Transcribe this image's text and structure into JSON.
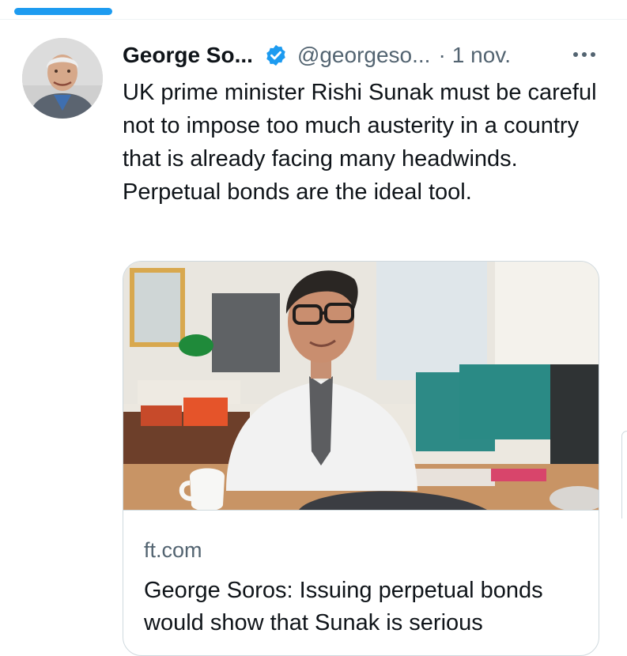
{
  "tweet": {
    "author_name": "George So...",
    "handle": "@georgeso...",
    "separator": "·",
    "timestamp": "1 nov.",
    "text": "UK prime minister Rishi Sunak must be careful not to impose too much austerity in a country that is already facing many headwinds. Perpetual bonds are the ideal tool.",
    "verified": true,
    "more_icon": "more-horizontal-icon"
  },
  "link_card": {
    "domain": "ft.com",
    "title": "George Soros: Issuing perpetual bonds would show that Sunak is serious"
  },
  "colors": {
    "accent": "#1d9bf0",
    "text_primary": "#0f1419",
    "text_secondary": "#536471",
    "border": "#cfd9de"
  }
}
